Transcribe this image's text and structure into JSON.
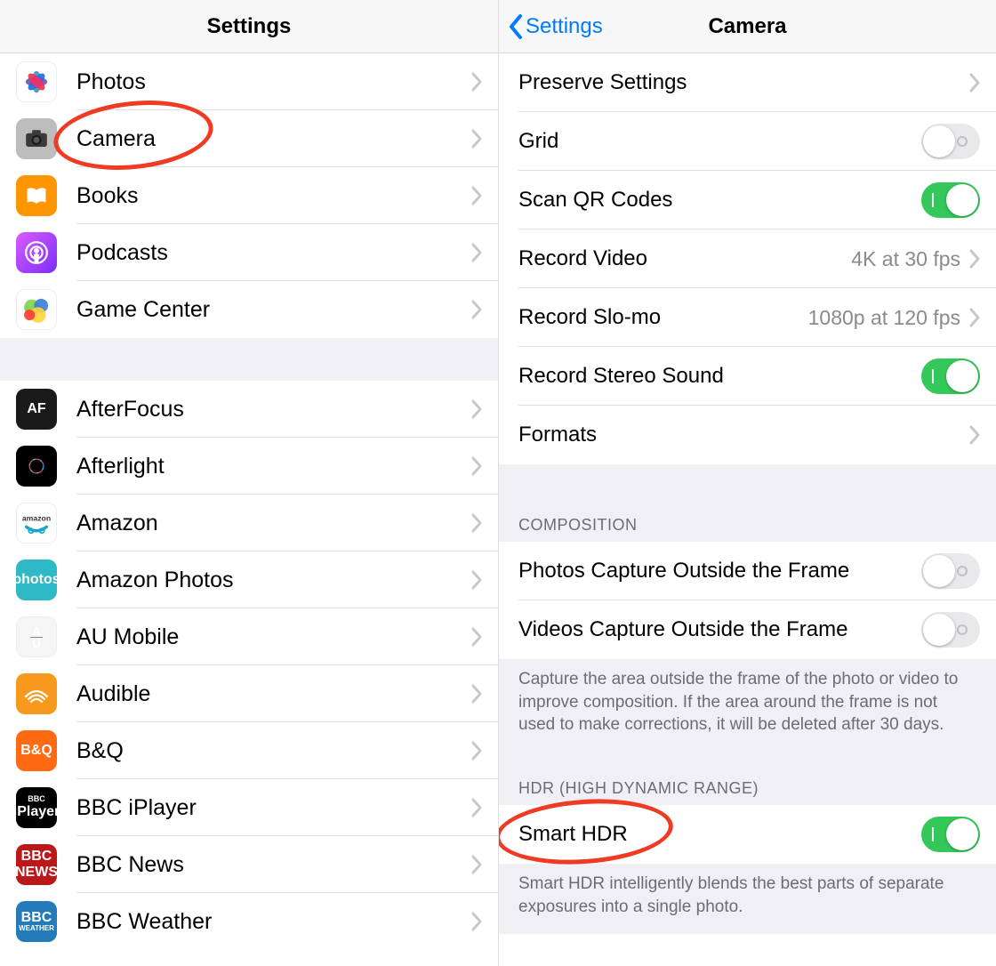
{
  "left": {
    "title": "Settings",
    "group1": [
      {
        "label": "Photos",
        "icon": "photos-icon"
      },
      {
        "label": "Camera",
        "icon": "camera-icon",
        "highlighted": true
      },
      {
        "label": "Books",
        "icon": "books-icon"
      },
      {
        "label": "Podcasts",
        "icon": "podcasts-icon"
      },
      {
        "label": "Game Center",
        "icon": "game-center-icon"
      }
    ],
    "group2": [
      {
        "label": "AfterFocus",
        "icon": "afterfocus-icon"
      },
      {
        "label": "Afterlight",
        "icon": "afterlight-icon"
      },
      {
        "label": "Amazon",
        "icon": "amazon-icon"
      },
      {
        "label": "Amazon Photos",
        "icon": "amazon-photos-icon"
      },
      {
        "label": "AU Mobile",
        "icon": "au-mobile-icon"
      },
      {
        "label": "Audible",
        "icon": "audible-icon"
      },
      {
        "label": "B&Q",
        "icon": "bandq-icon"
      },
      {
        "label": "BBC iPlayer",
        "icon": "bbc-iplayer-icon"
      },
      {
        "label": "BBC News",
        "icon": "bbc-news-icon"
      },
      {
        "label": "BBC Weather",
        "icon": "bbc-weather-icon"
      }
    ]
  },
  "right": {
    "back": "Settings",
    "title": "Camera",
    "main": {
      "preserve": {
        "label": "Preserve Settings"
      },
      "grid": {
        "label": "Grid",
        "on": false
      },
      "qr": {
        "label": "Scan QR Codes",
        "on": true
      },
      "video": {
        "label": "Record Video",
        "value": "4K at 30 fps"
      },
      "slomo": {
        "label": "Record Slo-mo",
        "value": "1080p at 120 fps"
      },
      "stereo": {
        "label": "Record Stereo Sound",
        "on": true
      },
      "formats": {
        "label": "Formats"
      }
    },
    "composition": {
      "header": "COMPOSITION",
      "photos": {
        "label": "Photos Capture Outside the Frame",
        "on": false
      },
      "videos": {
        "label": "Videos Capture Outside the Frame",
        "on": false
      },
      "footer": "Capture the area outside the frame of the photo or video to improve composition. If the area around the frame is not used to make corrections, it will be deleted after 30 days."
    },
    "hdr": {
      "header": "HDR (HIGH DYNAMIC RANGE)",
      "smart": {
        "label": "Smart HDR",
        "on": true,
        "highlighted": true
      },
      "footer": "Smart HDR intelligently blends the best parts of separate exposures into a single photo."
    }
  }
}
